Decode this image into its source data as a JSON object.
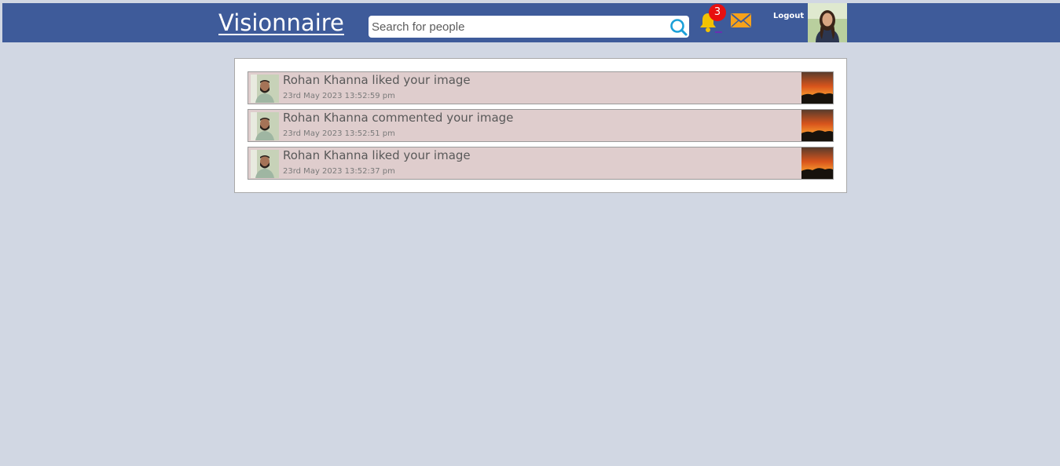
{
  "header": {
    "brand": "Visionnaire",
    "search_placeholder": "Search for people",
    "notification_count": "3",
    "logout_label": "Logout"
  },
  "notifications": [
    {
      "text": "Rohan Khanna liked your image",
      "time": "23rd May 2023 13:52:59 pm"
    },
    {
      "text": "Rohan Khanna commented your image",
      "time": "23rd May 2023 13:52:51 pm"
    },
    {
      "text": "Rohan Khanna liked your image",
      "time": "23rd May 2023 13:52:37 pm"
    }
  ],
  "icons": {
    "search": "search-icon",
    "bell": "bell-icon",
    "mail": "mail-icon"
  },
  "colors": {
    "header_bg": "#3e5b9a",
    "page_bg": "#d1d7e3",
    "notification_bg": "#dfcdcd",
    "badge": "#e80f0f",
    "bell": "#f2c200",
    "mail": "#f7a21b",
    "search_icon": "#1ba0d8"
  }
}
